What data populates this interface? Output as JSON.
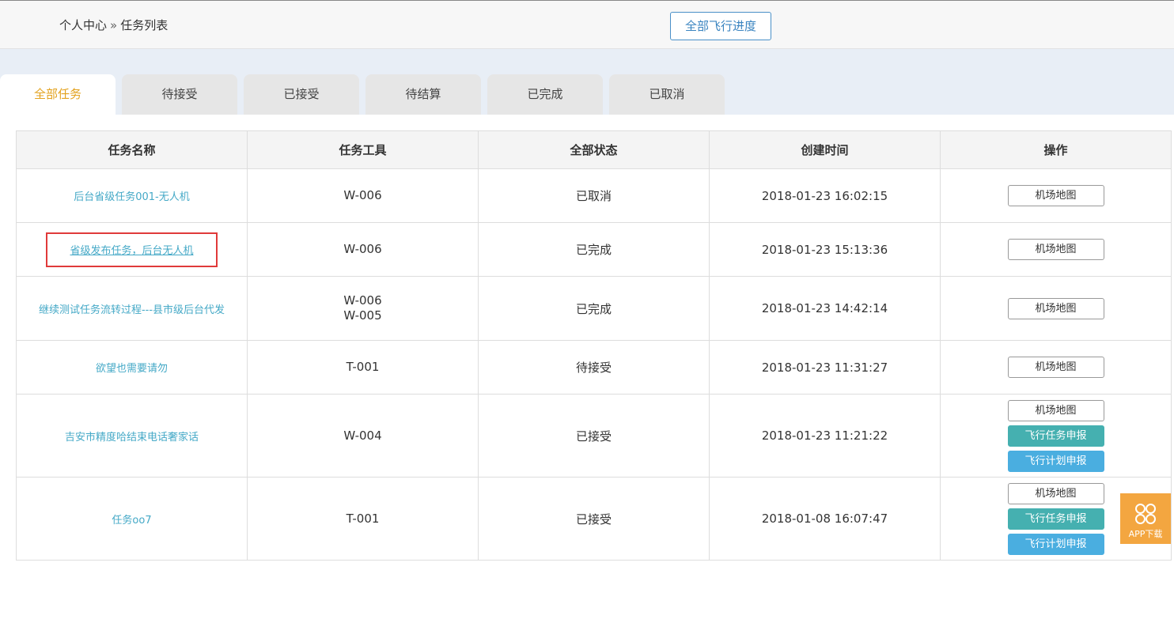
{
  "breadcrumb": {
    "home": "个人中心",
    "separator": "»",
    "current": "任务列表"
  },
  "header": {
    "progress_button": "全部飞行进度"
  },
  "tabs": [
    "全部任务",
    "待接受",
    "已接受",
    "待结算",
    "已完成",
    "已取消"
  ],
  "active_tab": "全部任务",
  "table": {
    "columns": [
      "任务名称",
      "任务工具",
      "全部状态",
      "创建时间",
      "操作"
    ],
    "rows": [
      {
        "name": "后台省级任务001-无人机",
        "tools": [
          "W-006"
        ],
        "status": "已取消",
        "created": "2018-01-23 16:02:15",
        "actions": [
          "机场地图"
        ]
      },
      {
        "name": "省级发布任务，后台无人机",
        "tools": [
          "W-006"
        ],
        "status": "已完成",
        "created": "2018-01-23 15:13:36",
        "actions": [
          "机场地图"
        ]
      },
      {
        "name": "继续测试任务流转过程---县市级后台代发",
        "tools": [
          "W-006",
          "W-005"
        ],
        "status": "已完成",
        "created": "2018-01-23 14:42:14",
        "actions": [
          "机场地图"
        ]
      },
      {
        "name": "欲望也需要请勿",
        "tools": [
          "T-001"
        ],
        "status": "待接受",
        "created": "2018-01-23 11:31:27",
        "actions": [
          "机场地图"
        ]
      },
      {
        "name": "吉安市精度哈结束电话奢家话",
        "tools": [
          "W-004"
        ],
        "status": "已接受",
        "created": "2018-01-23 11:21:22",
        "actions": [
          "机场地图",
          "飞行任务申报",
          "飞行计划申报"
        ]
      },
      {
        "name": "任务oo7",
        "tools": [
          "T-001"
        ],
        "status": "已接受",
        "created": "2018-01-08 16:07:47",
        "actions": [
          "机场地图",
          "飞行任务申报",
          "飞行计划申报"
        ]
      }
    ]
  },
  "app_download": {
    "label": "APP下载",
    "icon": "app-grid-icon"
  },
  "colors": {
    "link": "#45a9c7",
    "active_tab": "#e3a21e",
    "task_button": "#45b0b0",
    "plan_button": "#4aaee0",
    "app_badge": "#f3a640",
    "highlight": "#e03a3a"
  }
}
